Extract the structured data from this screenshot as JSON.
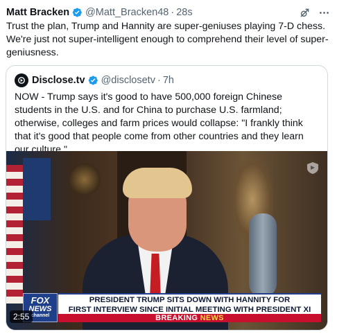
{
  "post": {
    "author_name": "Matt Bracken",
    "handle": "@Matt_Bracken48",
    "separator": "·",
    "time": "28s",
    "text": "Trust the plan, Trump and Hannity are super-geniuses playing 7-D chess. We're just not super-intelligent enough to comprehend their level of super-geniusness.",
    "icons": {
      "verified": "verified-badge-icon",
      "grok": "grok-icon",
      "more": "more-icon"
    }
  },
  "quote": {
    "author_name": "Disclose.tv",
    "handle": "@disclosetv",
    "separator": "·",
    "time": "7h",
    "text": "NOW - Trump says it's good to have 500,000 foreign Chinese students in the U.S. and for China to purchase U.S. farmland; otherwise, colleges and farm prices would collapse: \"I frankly think that it's good that people come from other countries and they learn our culture.\"",
    "media": {
      "duration": "2:55",
      "chyron_line1": "PRESIDENT TRUMP SITS DOWN WITH HANNITY FOR",
      "chyron_line2": "FIRST INTERVIEW SINCE INITIAL MEETING WITH PRESIDENT XI",
      "breaking": "BREAKING",
      "news": "NEWS",
      "logo_top": "FOX",
      "logo_bottom": "NEWS",
      "logo_sub": "channel"
    }
  },
  "colors": {
    "verified": "#1d9bf0",
    "secondary_text": "#536471",
    "border": "#cfd9de"
  }
}
